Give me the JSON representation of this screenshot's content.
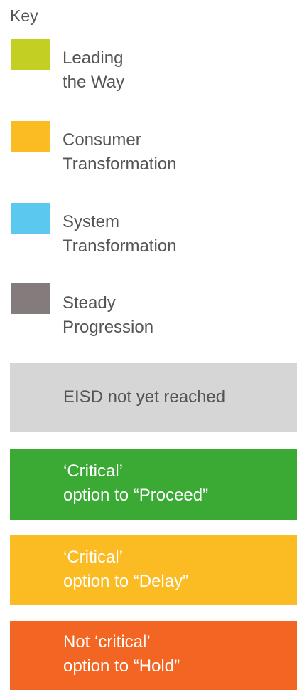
{
  "key": {
    "title": "Key"
  },
  "legend": {
    "items": [
      {
        "label": "Leading\nthe Way",
        "color": "#C4CF23"
      },
      {
        "label": "Consumer\nTransformation",
        "color": "#FBBB22"
      },
      {
        "label": "System\nTransformation",
        "color": "#5BC8F0"
      },
      {
        "label": "Steady\nProgression",
        "color": "#837B7C"
      }
    ]
  },
  "statuses": [
    {
      "label": "EISD not yet reached",
      "background": "#D6D6D6",
      "text_color": "#555555"
    },
    {
      "label": "‘Critical’\noption to “Proceed”",
      "background": "#3BAA35",
      "text_color": "#FFFFFF"
    },
    {
      "label": "‘Critical’\noption to “Delay”",
      "background": "#FBBB22",
      "text_color": "#FFFFFF"
    },
    {
      "label": "Not ‘critical’\noption to “Hold”",
      "background": "#F26522",
      "text_color": "#FFFFFF"
    }
  ]
}
